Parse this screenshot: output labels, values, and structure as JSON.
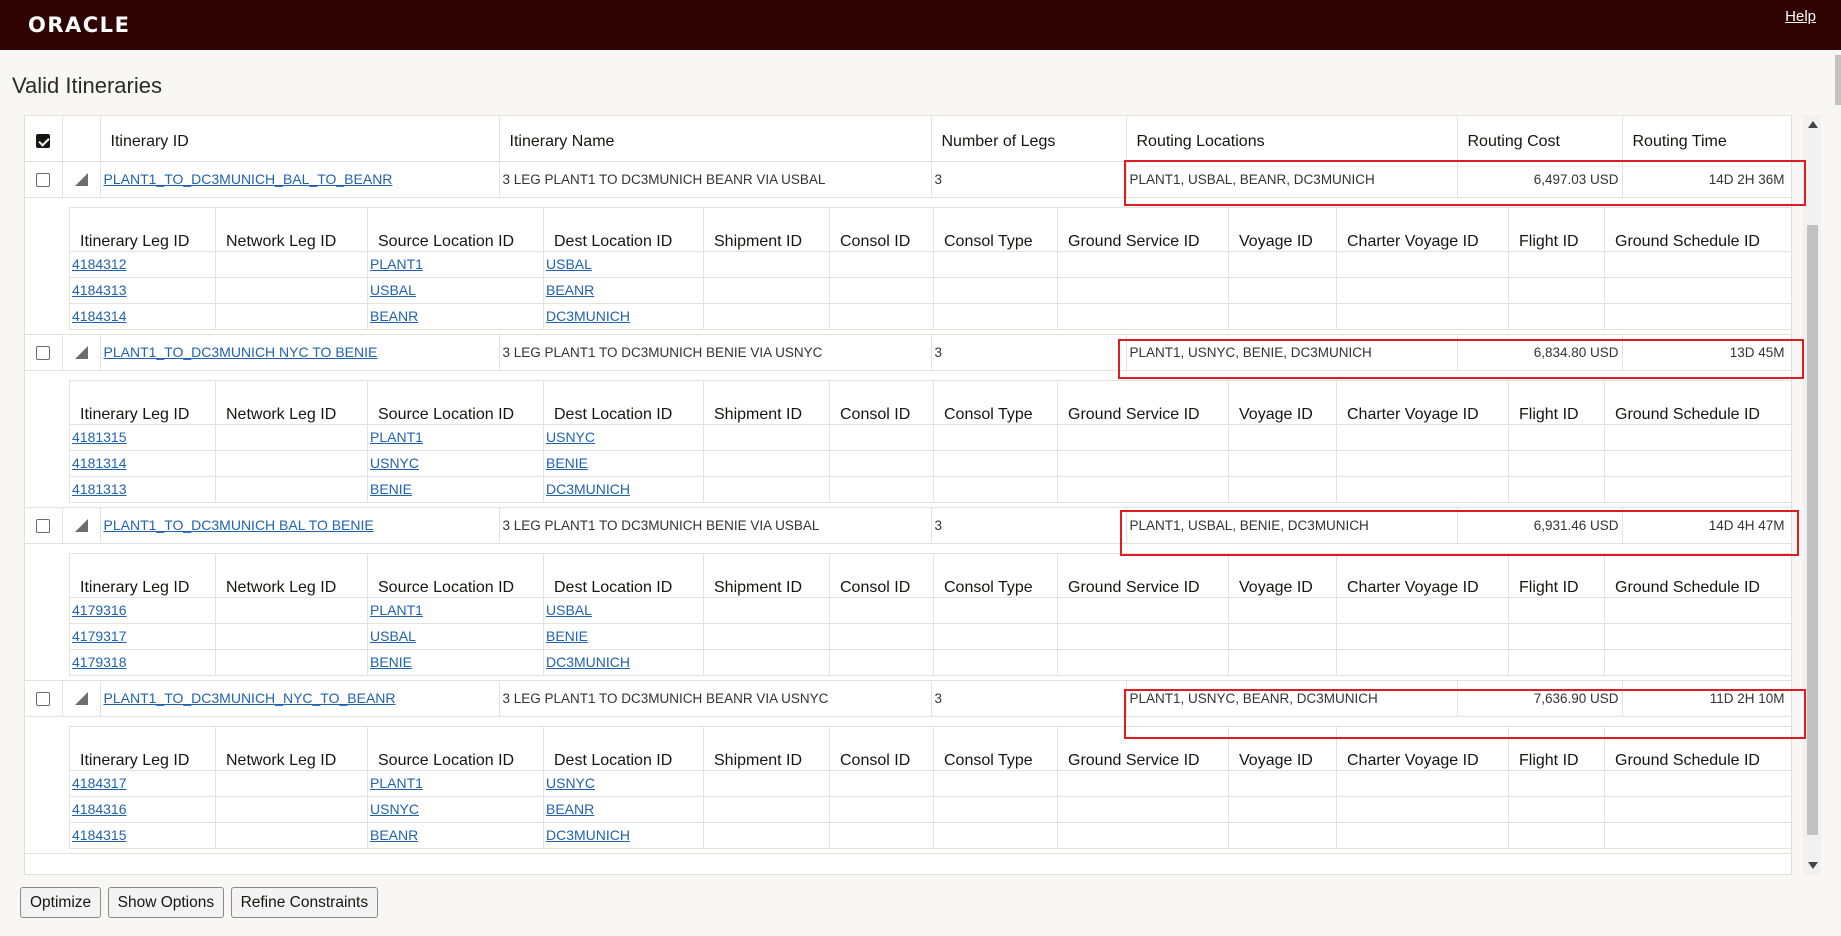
{
  "header": {
    "logo": "ORACLE",
    "help": "Help"
  },
  "page": {
    "title": "Valid Itineraries"
  },
  "main_columns": [
    "Itinerary ID",
    "Itinerary Name",
    "Number of Legs",
    "Routing Locations",
    "Routing Cost",
    "Routing Time"
  ],
  "leg_columns": [
    "Itinerary Leg ID",
    "Network Leg ID",
    "Source Location ID",
    "Dest Location ID",
    "Shipment ID",
    "Consol ID",
    "Consol Type",
    "Ground Service ID",
    "Voyage ID",
    "Charter Voyage ID",
    "Flight ID",
    "Ground Schedule ID"
  ],
  "itineraries": [
    {
      "id": "PLANT1_TO_DC3MUNICH_BAL_TO_BEANR",
      "name": "3 LEG PLANT1 TO DC3MUNICH BEANR VIA USBAL",
      "legs_count": "3",
      "routing_locations": "PLANT1, USBAL, BEANR, DC3MUNICH",
      "routing_cost": "6,497.03 USD",
      "routing_time": "14D 2H 36M",
      "legs": [
        {
          "leg_id": "4184312",
          "source": "PLANT1",
          "dest": "USBAL"
        },
        {
          "leg_id": "4184313",
          "source": "USBAL",
          "dest": "BEANR"
        },
        {
          "leg_id": "4184314",
          "source": "BEANR",
          "dest": "DC3MUNICH"
        }
      ]
    },
    {
      "id": "PLANT1_TO_DC3MUNICH NYC TO BENIE",
      "name": "3 LEG PLANT1 TO DC3MUNICH BENIE VIA USNYC",
      "legs_count": "3",
      "routing_locations": "PLANT1, USNYC, BENIE, DC3MUNICH",
      "routing_cost": "6,834.80 USD",
      "routing_time": "13D 45M",
      "legs": [
        {
          "leg_id": "4181315",
          "source": "PLANT1",
          "dest": "USNYC"
        },
        {
          "leg_id": "4181314",
          "source": "USNYC",
          "dest": "BENIE"
        },
        {
          "leg_id": "4181313",
          "source": "BENIE",
          "dest": "DC3MUNICH"
        }
      ]
    },
    {
      "id": "PLANT1_TO_DC3MUNICH BAL TO BENIE",
      "name": "3 LEG PLANT1 TO DC3MUNICH BENIE VIA USBAL",
      "legs_count": "3",
      "routing_locations": "PLANT1, USBAL, BENIE, DC3MUNICH",
      "routing_cost": "6,931.46 USD",
      "routing_time": "14D 4H 47M",
      "legs": [
        {
          "leg_id": "4179316",
          "source": "PLANT1",
          "dest": "USBAL"
        },
        {
          "leg_id": "4179317",
          "source": "USBAL",
          "dest": "BENIE"
        },
        {
          "leg_id": "4179318",
          "source": "BENIE",
          "dest": "DC3MUNICH"
        }
      ]
    },
    {
      "id": "PLANT1_TO_DC3MUNICH_NYC_TO_BEANR",
      "name": "3 LEG PLANT1 TO DC3MUNICH BEANR VIA USNYC",
      "legs_count": "3",
      "routing_locations": "PLANT1, USNYC, BEANR, DC3MUNICH",
      "routing_cost": "7,636.90 USD",
      "routing_time": "11D 2H 10M",
      "legs": [
        {
          "leg_id": "4184317",
          "source": "PLANT1",
          "dest": "USNYC"
        },
        {
          "leg_id": "4184316",
          "source": "USNYC",
          "dest": "BEANR"
        },
        {
          "leg_id": "4184315",
          "source": "BEANR",
          "dest": "DC3MUNICH"
        }
      ]
    }
  ],
  "buttons": {
    "optimize": "Optimize",
    "show_options": "Show Options",
    "refine_constraints": "Refine Constraints"
  },
  "colors": {
    "header_bg": "#300303",
    "link": "#1f63b0",
    "highlight": "#e11b22"
  }
}
